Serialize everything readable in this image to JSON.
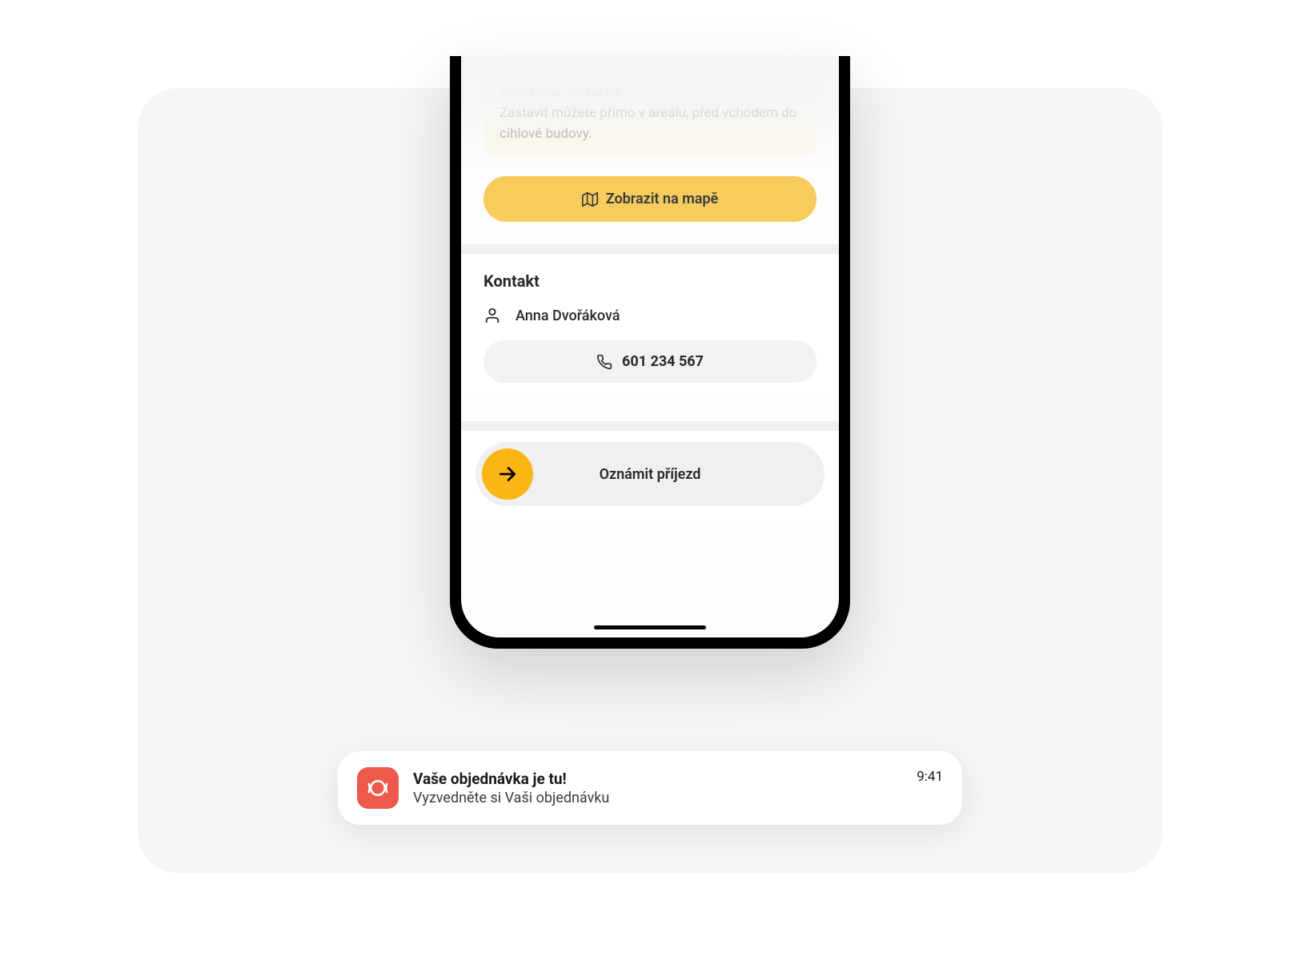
{
  "courier_note": {
    "label": "Poznámka pro kurýra",
    "text": "Zastavit můžete přímo v areálu, před vchodem do cihlové budovy."
  },
  "map_button": {
    "label": "Zobrazit na mapě"
  },
  "contact": {
    "title": "Kontakt",
    "name": "Anna Dvořáková",
    "phone": "601 234 567"
  },
  "arrival_button": {
    "label": "Oznámit příjezd"
  },
  "notification": {
    "title": "Vaše objednávka je tu!",
    "body": "Vyzvedněte si Vaši objednávku",
    "time": "9:41"
  }
}
